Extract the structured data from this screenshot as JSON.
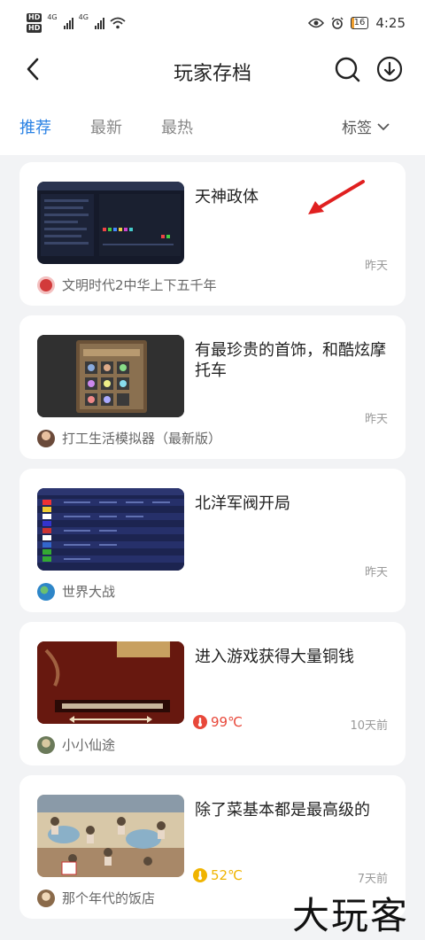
{
  "status_bar": {
    "hd1": "HD",
    "hd2": "HD",
    "signal1": "4G",
    "signal2": "4G",
    "battery": "16",
    "time": "4:25"
  },
  "header": {
    "title": "玩家存档",
    "back_icon": "back-arrow-icon",
    "search_icon": "search-icon",
    "download_icon": "download-icon"
  },
  "tabs": [
    {
      "label": "推荐",
      "active": true
    },
    {
      "label": "最新",
      "active": false
    },
    {
      "label": "最热",
      "active": false
    }
  ],
  "tag_filter": {
    "label": "标签",
    "icon": "chevron-down-icon"
  },
  "cards": [
    {
      "title": "天神政体",
      "time": "昨天",
      "heat": "",
      "game": "文明时代2中华上下五千年",
      "game_icon_color": "#d23a3a"
    },
    {
      "title": "有最珍贵的首饰，和酷炫摩托车",
      "time": "昨天",
      "heat": "",
      "game": "打工生活模拟器（最新版）",
      "game_icon_color": "#6a4a3a"
    },
    {
      "title": "北洋军阀开局",
      "time": "昨天",
      "heat": "",
      "game": "世界大战",
      "game_icon_color": "#2e86c8"
    },
    {
      "title": "进入游戏获得大量铜钱",
      "time": "10天前",
      "heat": "99℃",
      "heat_color": "#e8483a",
      "game": "小小仙途",
      "game_icon_color": "#6b7a5a"
    },
    {
      "title": "除了菜基本都是最高级的",
      "time": "7天前",
      "heat": "52℃",
      "heat_color": "#f0b400",
      "game": "那个年代的饭店",
      "game_icon_color": "#8a6a4a"
    }
  ],
  "watermark": "大玩客"
}
